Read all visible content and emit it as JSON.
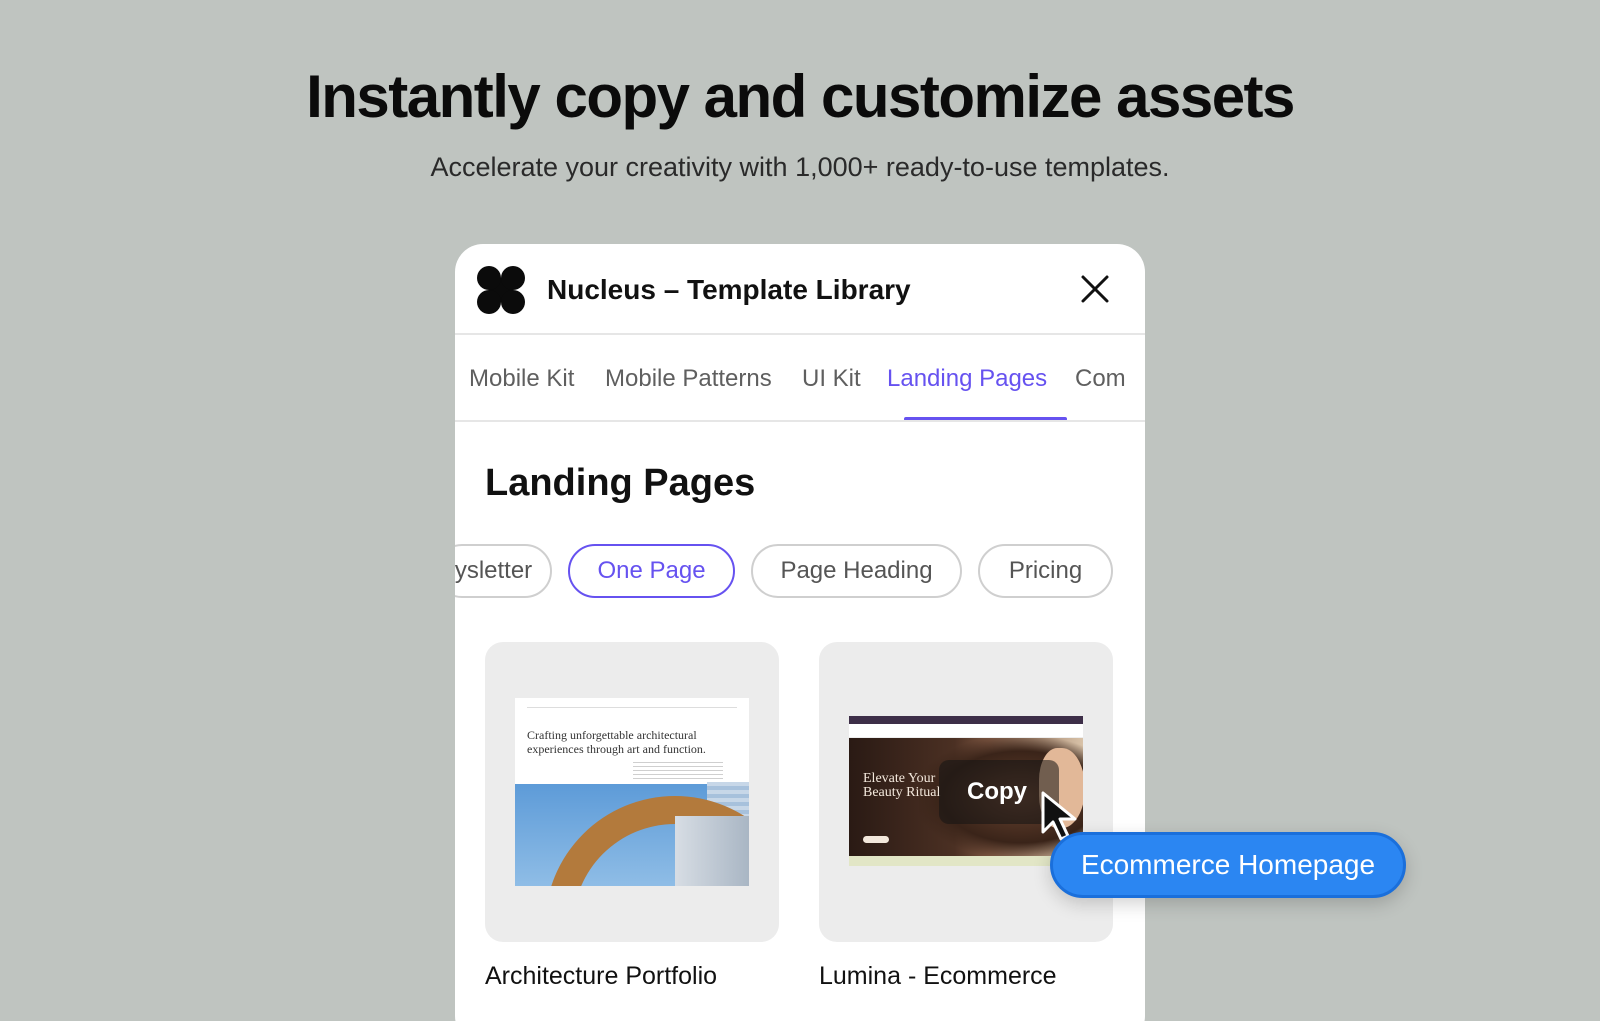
{
  "hero": {
    "title": "Instantly copy and customize assets",
    "subtitle": "Accelerate your creativity with 1,000+ ready-to-use templates."
  },
  "panel": {
    "title": "Nucleus – Template Library",
    "logo_icon": "clover-logo-icon",
    "close_icon": "close-icon"
  },
  "tabs": [
    {
      "label": "Mobile Kit"
    },
    {
      "label": "Mobile Patterns"
    },
    {
      "label": "UI Kit"
    },
    {
      "label": "Landing Pages",
      "active": true
    },
    {
      "label": "Com"
    }
  ],
  "section": {
    "title": "Landing Pages"
  },
  "chips": [
    {
      "label": "ysletter"
    },
    {
      "label": "One Page",
      "active": true
    },
    {
      "label": "Page Heading"
    },
    {
      "label": "Pricing"
    }
  ],
  "cards": [
    {
      "label": "Architecture Portfolio",
      "thumb_text": "Crafting unforgettable architectural experiences through art and function."
    },
    {
      "label": "Lumina - Ecommerce",
      "thumb_text": "Elevate Your Beauty Ritual",
      "hover_action": "Copy"
    }
  ],
  "tooltip": {
    "label": "Ecommerce Homepage"
  },
  "colors": {
    "accent": "#6652f0",
    "tooltip": "#2b86f2",
    "background": "#bfc4c0"
  }
}
